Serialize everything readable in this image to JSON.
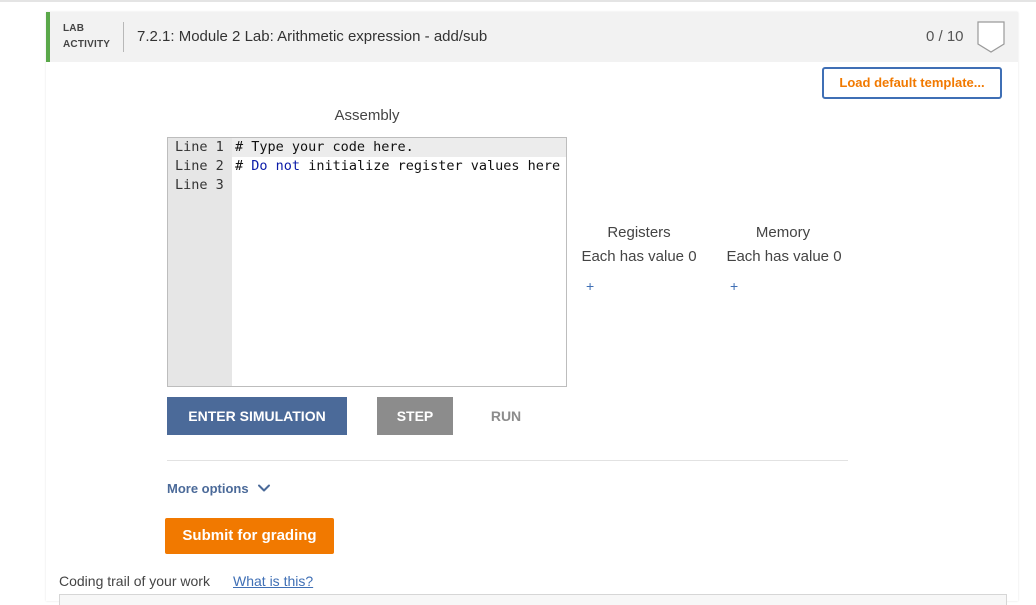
{
  "header": {
    "tag_line1": "LAB",
    "tag_line2": "ACTIVITY",
    "title": "7.2.1: Module 2 Lab: Arithmetic expression - add/sub",
    "score": "0 / 10",
    "accent_color": "#5aa84a",
    "badge_icon": "shield-badge-icon"
  },
  "toolbar": {
    "load_template_label": "Load default template..."
  },
  "editor": {
    "label": "Assembly",
    "lines": [
      {
        "number": "Line 1",
        "text": "# Type your code here."
      },
      {
        "number": "Line 2",
        "text": "# Do not initialize register values here"
      },
      {
        "number": "Line 3",
        "text": ""
      }
    ]
  },
  "registers": {
    "title": "Registers",
    "subtitle": "Each has value 0",
    "add_label": "+"
  },
  "memory": {
    "title": "Memory",
    "subtitle": "Each has value 0",
    "add_label": "+"
  },
  "simulation": {
    "enter_label": "ENTER SIMULATION",
    "step_label": "STEP",
    "run_label": "RUN"
  },
  "more_options": {
    "label": "More options",
    "icon": "chevron-down-icon"
  },
  "submit_label": "Submit for grading",
  "trail": {
    "label": "Coding trail of your work",
    "link": "What is this?"
  },
  "colors": {
    "accent": "#f17900",
    "primary": "#4b6a99",
    "link": "#3f6fb5"
  }
}
